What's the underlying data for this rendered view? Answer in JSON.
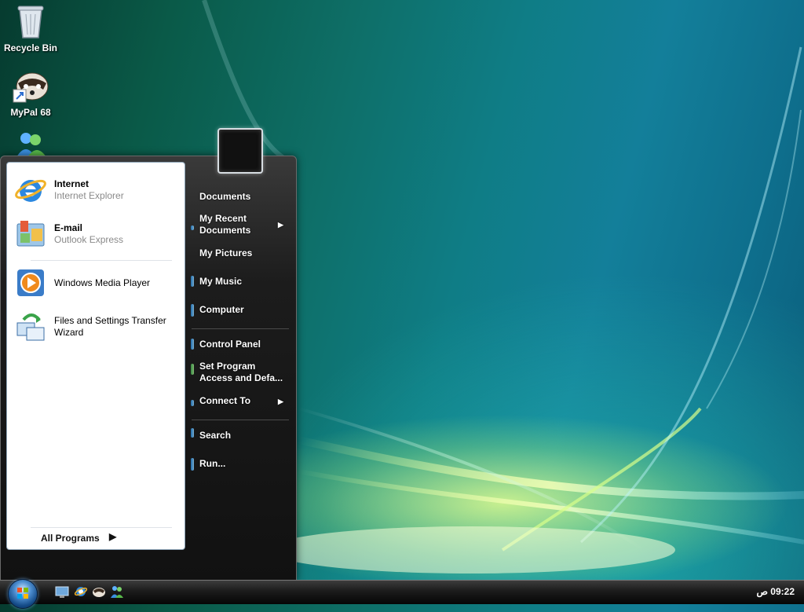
{
  "desktop": {
    "icons": [
      {
        "label": "Recycle Bin",
        "icon": "recycle-bin-icon"
      },
      {
        "label": "MyPal 68",
        "icon": "mypal-raccoon-icon"
      },
      {
        "label": "",
        "icon": "messenger-icon"
      }
    ]
  },
  "start_menu": {
    "pinned": [
      {
        "title": "Internet",
        "subtitle": "Internet Explorer",
        "icon": "internet-explorer-icon"
      },
      {
        "title": "E-mail",
        "subtitle": "Outlook Express",
        "icon": "outlook-express-icon"
      }
    ],
    "recent": [
      {
        "title": "Windows Media Player",
        "icon": "windows-media-player-icon"
      },
      {
        "title": "Files and Settings Transfer Wizard",
        "icon": "transfer-wizard-icon"
      }
    ],
    "all_programs": "All Programs",
    "right_items": [
      {
        "label": "Documents",
        "submenu": false
      },
      {
        "label": "My Recent Documents",
        "submenu": true
      },
      {
        "label": "My Pictures",
        "submenu": false
      },
      {
        "label": "My Music",
        "submenu": false
      },
      {
        "label": "Computer",
        "submenu": false
      },
      {
        "label": "Control Panel",
        "submenu": false
      },
      {
        "label": "Set Program Access and Defa...",
        "submenu": false
      },
      {
        "label": "Connect To",
        "submenu": true
      },
      {
        "label": "Search",
        "submenu": false
      },
      {
        "label": "Run...",
        "submenu": false
      }
    ]
  },
  "taskbar": {
    "quick_launch": [
      "show-desktop-icon",
      "internet-explorer-icon",
      "mypal-raccoon-icon",
      "messenger-icon"
    ],
    "clock": "09:22 ص"
  },
  "colors": {
    "taskbar": "#1b1b1b",
    "start_menu_right": "#1c1c1c",
    "start_menu_left": "#ffffff",
    "accent": "#1e7fd0"
  }
}
